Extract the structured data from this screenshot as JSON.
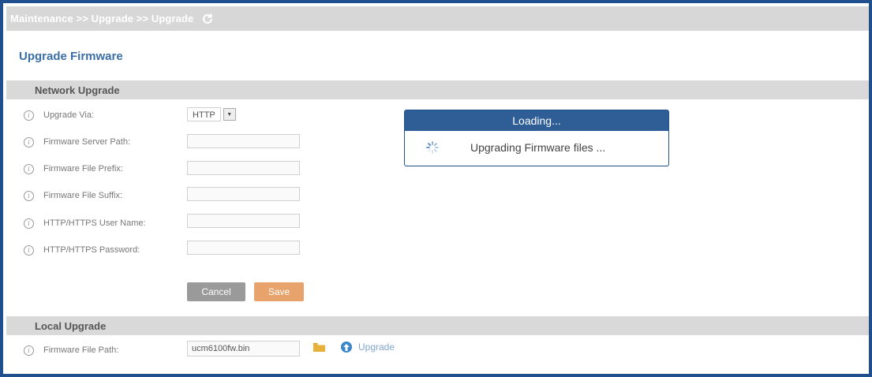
{
  "header": {
    "breadcrumb": "Maintenance >> Upgrade >> Upgrade"
  },
  "page": {
    "title": "Upgrade Firmware"
  },
  "network_upgrade": {
    "section_title": "Network Upgrade",
    "fields": [
      {
        "label": "Upgrade Via:",
        "value": "HTTP"
      },
      {
        "label": "Firmware Server Path:",
        "value": ""
      },
      {
        "label": "Firmware File Prefix:",
        "value": ""
      },
      {
        "label": "Firmware File Suffix:",
        "value": ""
      },
      {
        "label": "HTTP/HTTPS User Name:",
        "value": ""
      },
      {
        "label": "HTTP/HTTPS Password:",
        "value": ""
      }
    ],
    "cancel_label": "Cancel",
    "save_label": "Save"
  },
  "local_upgrade": {
    "section_title": "Local Upgrade",
    "file_path_label": "Firmware File Path:",
    "file_path_value": "ucm6100fw.bin",
    "upgrade_label": "Upgrade"
  },
  "modal": {
    "title": "Loading...",
    "message": "Upgrading Firmware files ..."
  },
  "colors": {
    "frame": "#1f4f8c",
    "title": "#3a6ea5",
    "save": "#e8a36d",
    "cancel": "#9a9a9a",
    "modal_header": "#2e5e95"
  },
  "icons": [
    "refresh-icon",
    "info-icon",
    "chevron-down-icon",
    "folder-icon",
    "upload-icon",
    "spinner-icon"
  ]
}
